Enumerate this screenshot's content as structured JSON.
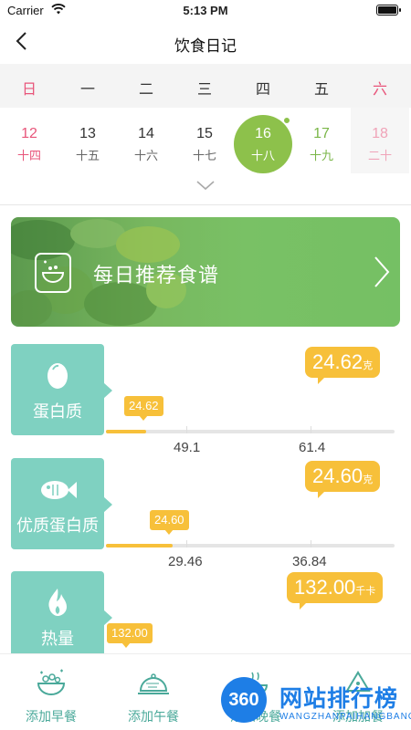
{
  "status_bar": {
    "carrier": "Carrier",
    "time": "5:13 PM"
  },
  "nav": {
    "title": "饮食日记"
  },
  "week": {
    "weekdays": [
      "日",
      "一",
      "二",
      "三",
      "四",
      "五",
      "六"
    ],
    "dates": [
      {
        "num": "12",
        "lunar": "十四"
      },
      {
        "num": "13",
        "lunar": "十五"
      },
      {
        "num": "14",
        "lunar": "十六"
      },
      {
        "num": "15",
        "lunar": "十七"
      },
      {
        "num": "16",
        "lunar": "十八"
      },
      {
        "num": "17",
        "lunar": "十九"
      },
      {
        "num": "18",
        "lunar": "二十"
      }
    ],
    "selected_index": 4
  },
  "banner": {
    "label": "每日推荐食谱"
  },
  "nutrients": [
    {
      "name": "蛋白质",
      "icon": "egg-icon",
      "value": "24.62",
      "unit": "克",
      "marker": "24.62",
      "ticks": [
        "49.1",
        "61.4"
      ],
      "progress_fraction": 0.14
    },
    {
      "name": "优质蛋白质",
      "icon": "fish-icon",
      "value": "24.60",
      "unit": "克",
      "marker": "24.60",
      "ticks": [
        "29.46",
        "36.84"
      ],
      "progress_fraction": 0.23
    },
    {
      "name": "热量",
      "icon": "flame-icon",
      "value": "132.00",
      "unit": "千卡",
      "marker": "132.00",
      "ticks": [],
      "progress_fraction": 0.06
    }
  ],
  "tabbar": {
    "items": [
      {
        "label": "添加早餐",
        "icon": "breakfast-bowl-icon"
      },
      {
        "label": "添加午餐",
        "icon": "lunch-cloche-icon"
      },
      {
        "label": "添加晚餐",
        "icon": "dinner-icon"
      },
      {
        "label": "添加加餐",
        "icon": "snack-icon"
      }
    ]
  },
  "watermark": {
    "badge": "360",
    "title": "网站排行榜",
    "subtitle": "WANGZHANPAIHANGBANG"
  },
  "colors": {
    "accent_green": "#8dc14b",
    "teal": "#7fd1c1",
    "yellow": "#f7c03a",
    "red": "#e8557a"
  }
}
